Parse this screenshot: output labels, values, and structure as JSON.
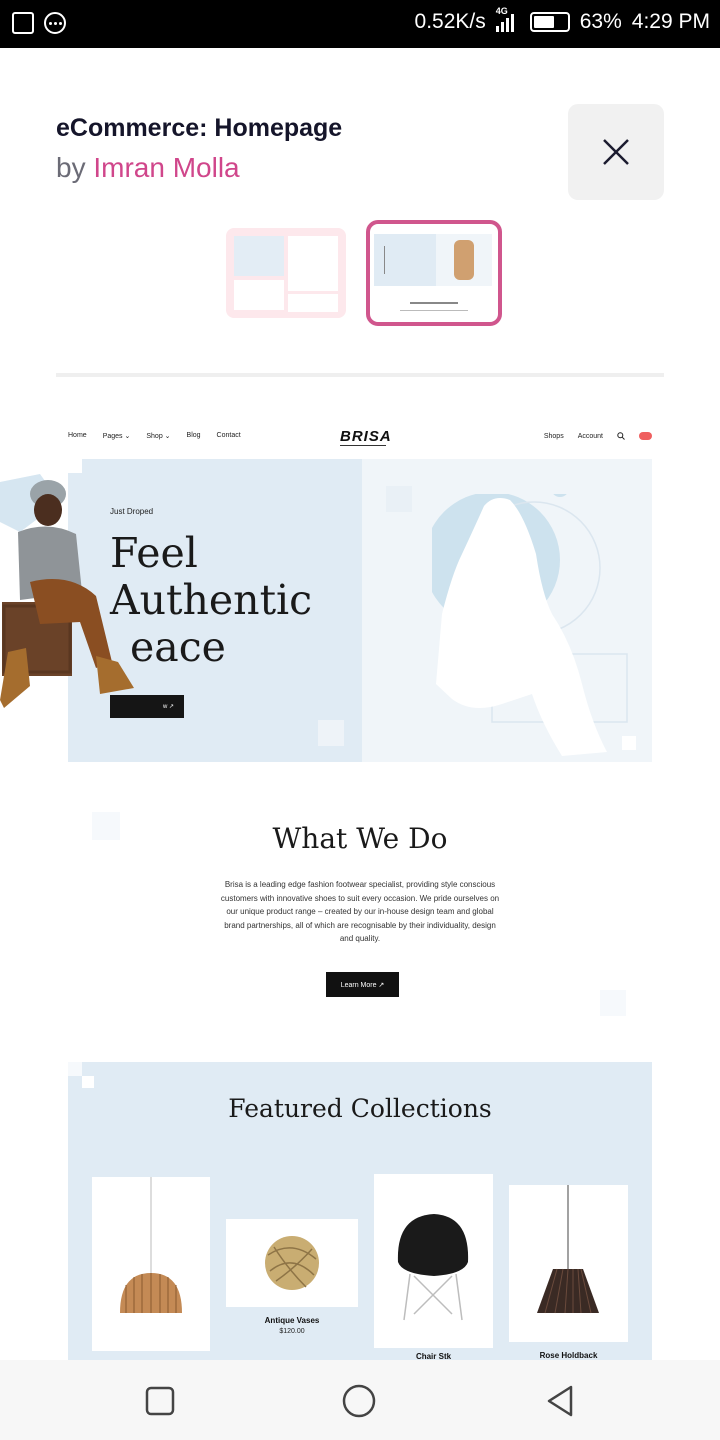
{
  "status_bar": {
    "network_speed": "0.52K/s",
    "network_type": "4G",
    "battery": "63%",
    "time": "4:29 PM"
  },
  "header": {
    "title": "eCommerce: Homepage",
    "by_prefix": "by",
    "author": "Imran Molla"
  },
  "preview": {
    "nav": {
      "left_items": [
        "Home",
        "Pages ⌄",
        "Shop ⌄",
        "Blog",
        "Contact"
      ],
      "logo": "BRISA",
      "right_items": [
        "Shops",
        "Account"
      ]
    },
    "hero": {
      "eyebrow": "Just Droped",
      "title_line1": "Feel",
      "title_line2": "Authentic",
      "title_line3": "eace",
      "button": "w ↗"
    },
    "what_we_do": {
      "title": "What We Do",
      "body": "Brisa is a leading edge fashion footwear specialist, providing style conscious customers with innovative shoes to suit every occasion. We pride ourselves on our unique product range – created by our in-house design team and global brand partnerships, all of which are recognisable by their individuality, design and quality.",
      "button": "Learn More ↗"
    },
    "featured": {
      "title": "Featured Collections",
      "items": [
        {
          "name": "",
          "price": ""
        },
        {
          "name": "Antique Vases",
          "price": "$120.00"
        },
        {
          "name": "Chair Stk",
          "price": ""
        },
        {
          "name": "Rose Holdback",
          "price": ""
        }
      ]
    }
  },
  "colors": {
    "accent": "#d0468b",
    "hero_bg": "#e0ebf4",
    "dark": "#111111"
  }
}
